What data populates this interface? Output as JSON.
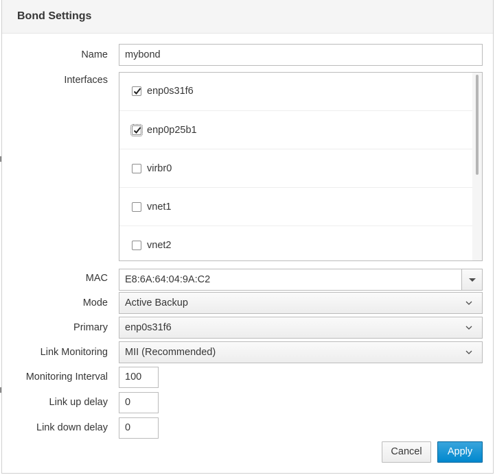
{
  "dialog": {
    "title": "Bond Settings"
  },
  "form": {
    "name_label": "Name",
    "name_value": "mybond",
    "interfaces_label": "Interfaces",
    "interfaces": [
      {
        "label": "enp0s31f6",
        "checked": true
      },
      {
        "label": "enp0p25b1",
        "checked": true
      },
      {
        "label": "virbr0",
        "checked": false
      },
      {
        "label": "vnet1",
        "checked": false
      },
      {
        "label": "vnet2",
        "checked": false
      }
    ],
    "mac_label": "MAC",
    "mac_value": "E8:6A:64:04:9A:C2",
    "mode_label": "Mode",
    "mode_value": "Active Backup",
    "primary_label": "Primary",
    "primary_value": "enp0s31f6",
    "link_monitoring_label": "Link Monitoring",
    "link_monitoring_value": "MII (Recommended)",
    "monitoring_interval_label": "Monitoring Interval",
    "monitoring_interval_value": "100",
    "link_up_delay_label": "Link up delay",
    "link_up_delay_value": "0",
    "link_down_delay_label": "Link down delay",
    "link_down_delay_value": "0"
  },
  "footer": {
    "cancel_label": "Cancel",
    "apply_label": "Apply"
  },
  "colors": {
    "primary_button": "#0088ce",
    "header_background": "#f5f5f5",
    "border": "#bbbbbb"
  }
}
